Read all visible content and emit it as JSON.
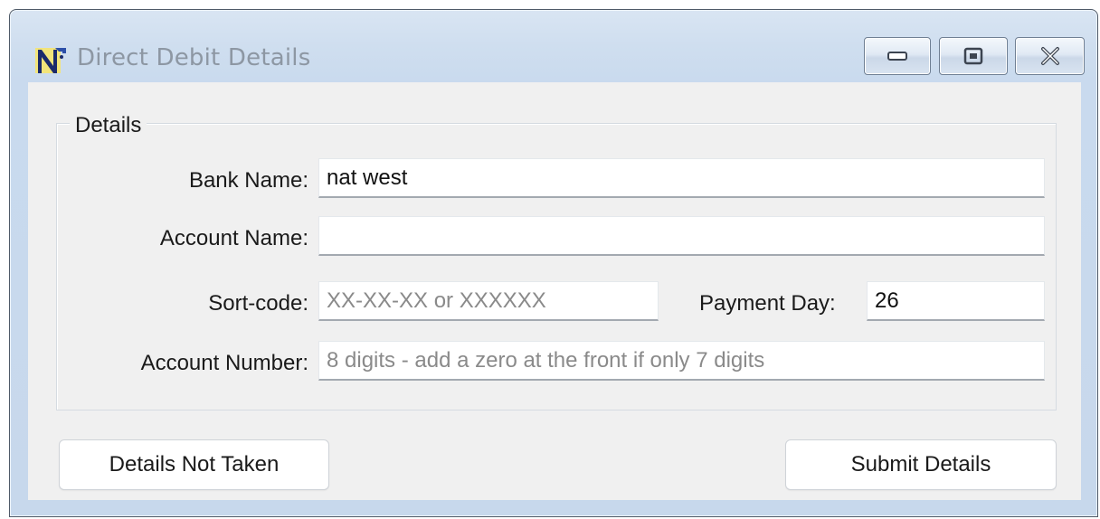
{
  "window": {
    "title": "Direct Debit Details"
  },
  "icons": {
    "app": "app-logo-icon",
    "minimize": "minimize-icon",
    "maximize": "maximize-icon",
    "close": "close-icon"
  },
  "details": {
    "group_label": "Details",
    "bank_name_label": "Bank Name:",
    "bank_name_value": "nat west",
    "account_name_label": "Account Name:",
    "account_name_value": "",
    "sort_code_label": "Sort-code:",
    "sort_code_placeholder": "XX-XX-XX or XXXXXX",
    "payment_day_label": "Payment Day:",
    "payment_day_value": "26",
    "account_number_label": "Account Number:",
    "account_number_placeholder": "8 digits - add a zero at the front if only 7 digits"
  },
  "actions": {
    "not_taken_label": "Details Not Taken",
    "submit_label": "Submit Details"
  },
  "colors": {
    "titlebar": "#cfdeef",
    "client_bg": "#f0f0f0",
    "title_text": "#8d97a3"
  }
}
